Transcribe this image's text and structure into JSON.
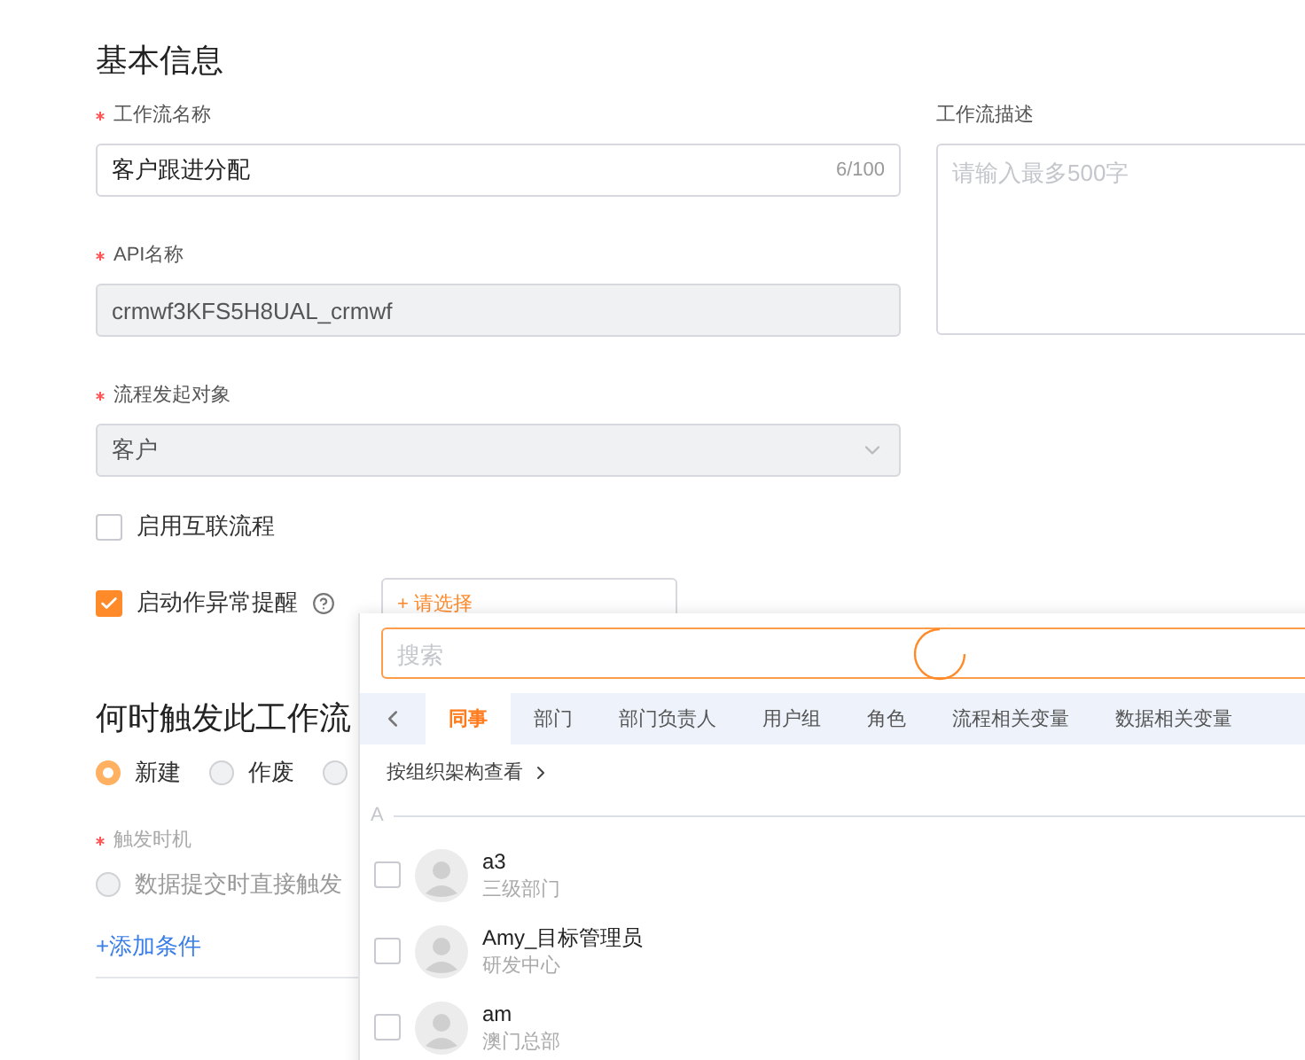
{
  "basic": {
    "title": "基本信息"
  },
  "fields": [
    {
      "kind": "text",
      "label": "工作流名称",
      "required": true,
      "value": "客户跟进分配",
      "counter": "6/100"
    },
    {
      "kind": "readonly",
      "label": "API名称",
      "required": true,
      "value": "crmwf3KFS5H8UAL_crmwf"
    },
    {
      "kind": "select",
      "label": "流程发起对象",
      "required": true,
      "value": "客户"
    }
  ],
  "description": {
    "label": "工作流描述",
    "placeholder": "请输入最多500字"
  },
  "options": [
    {
      "label": "启用互联流程",
      "checked": false,
      "help": false
    },
    {
      "label": "启动作异常提醒",
      "checked": true,
      "help": true,
      "picker": "+ 请选择"
    }
  ],
  "trigger": {
    "title": "何时触发此工作流",
    "events": [
      {
        "label": "新建",
        "selected": true
      },
      {
        "label": "作废",
        "selected": false
      },
      {
        "selected": false
      }
    ],
    "timing": {
      "label": "触发时机",
      "required": true,
      "options": [
        {
          "label": "数据提交时直接触发",
          "selected": false
        }
      ]
    },
    "add_condition": "+添加条件"
  },
  "popup": {
    "search_placeholder": "搜索",
    "loading": true,
    "tabs": [
      {
        "label": "同事",
        "selected": true
      },
      {
        "label": "部门",
        "selected": false
      },
      {
        "label": "部门负责人",
        "selected": false
      },
      {
        "label": "用户组",
        "selected": false
      },
      {
        "label": "角色",
        "selected": false
      },
      {
        "label": "流程相关变量",
        "selected": false
      },
      {
        "label": "数据相关变量",
        "selected": false
      }
    ],
    "org_link": "按组织架构查看",
    "group": "A",
    "people": [
      {
        "name": "a3",
        "dept": "三级部门",
        "checked": false
      },
      {
        "name": "Amy_目标管理员",
        "dept": "研发中心",
        "checked": false
      },
      {
        "name": "am",
        "dept": "澳门总部",
        "checked": false
      }
    ]
  }
}
